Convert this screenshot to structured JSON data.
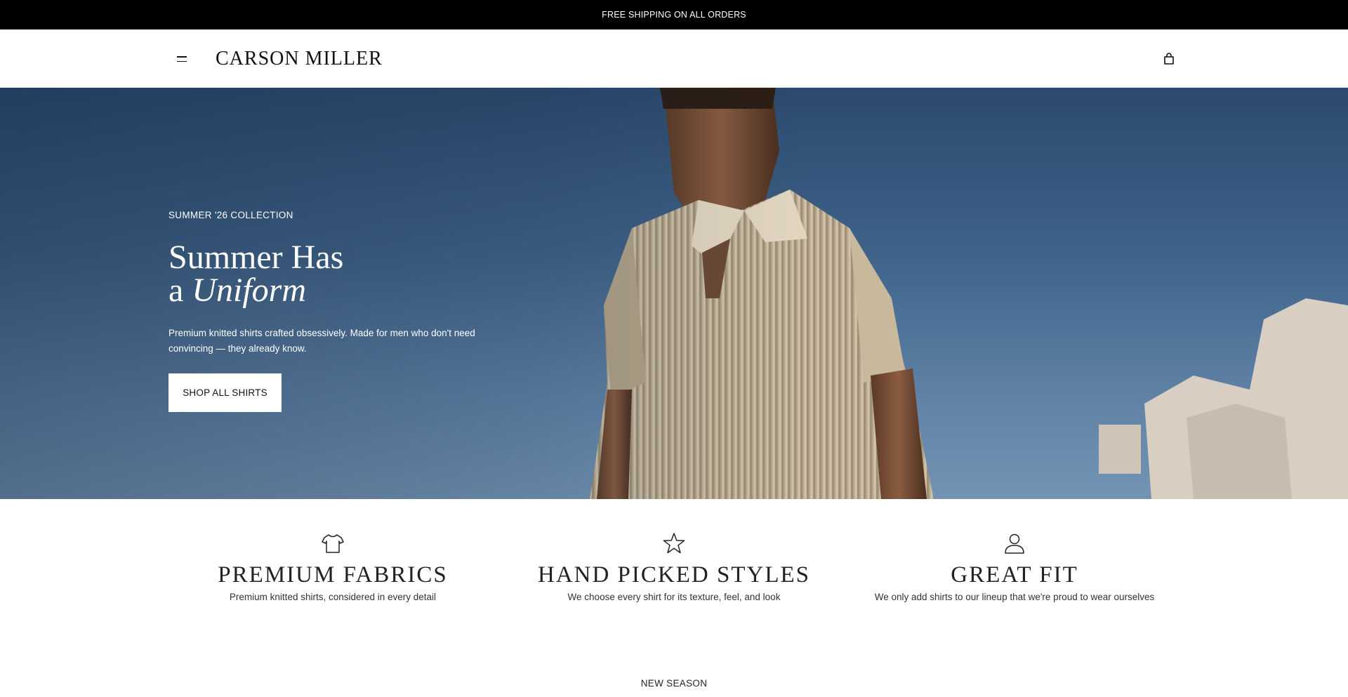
{
  "announcement": {
    "text": "FREE SHIPPING ON ALL ORDERS"
  },
  "header": {
    "logo": "CARSON MILLER",
    "menu_icon": "hamburger-menu-icon",
    "cart_icon": "shopping-bag-icon"
  },
  "hero": {
    "eyebrow": "SUMMER '26 COLLECTION",
    "title_line1": "Summer Has",
    "title_line2_prefix": "a",
    "title_line2_italic": "Uniform",
    "description": "Premium knitted shirts crafted obsessively. Made for men who don't need convincing — they already know.",
    "cta_label": "SHOP ALL SHIRTS"
  },
  "features": [
    {
      "icon": "tshirt-icon",
      "title": "PREMIUM FABRICS",
      "description": "Premium knitted shirts, considered in every detail"
    },
    {
      "icon": "star-icon",
      "title": "HAND PICKED STYLES",
      "description": "We choose every shirt for its texture, feel, and look"
    },
    {
      "icon": "person-icon",
      "title": "GREAT FIT",
      "description": "We only add shirts to our lineup that we're proud to wear ourselves"
    }
  ],
  "next_section": {
    "eyebrow": "NEW SEASON"
  },
  "colors": {
    "announcement_bg": "#000000",
    "sky": "#3f6288",
    "shirt": "#cbbba0",
    "text": "#111111"
  }
}
